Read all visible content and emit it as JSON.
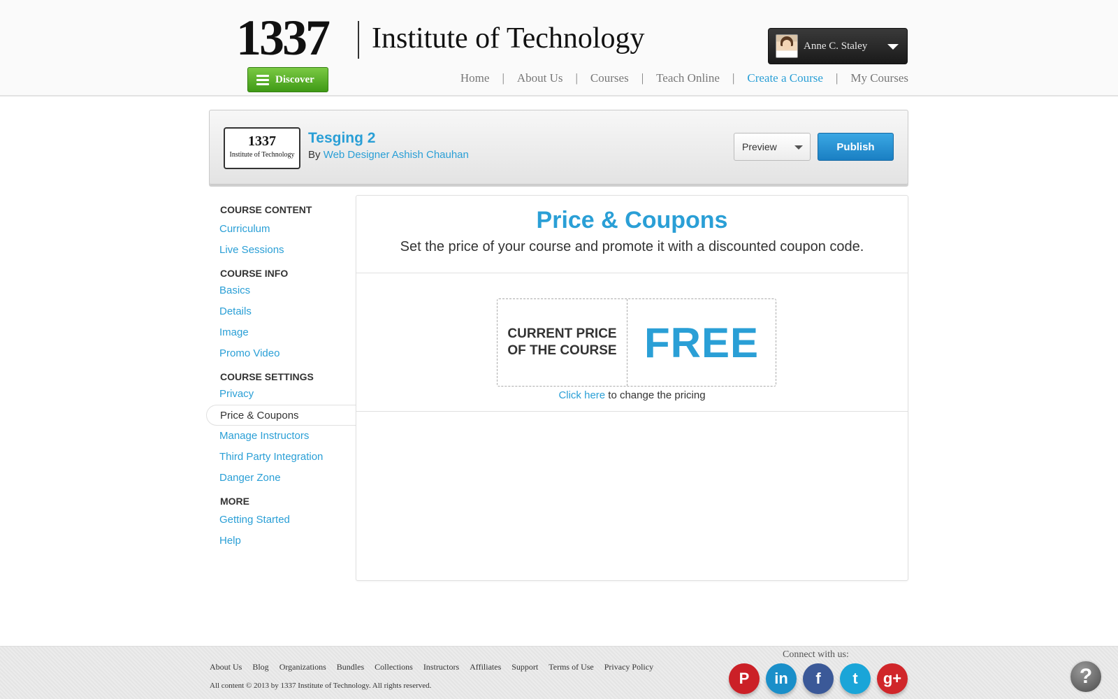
{
  "header": {
    "logo_number": "1337",
    "logo_name": "Institute of Technology",
    "discover_label": "Discover",
    "user_name": "Anne C. Staley",
    "nav": [
      {
        "label": "Home"
      },
      {
        "label": "About Us"
      },
      {
        "label": "Courses"
      },
      {
        "label": "Teach Online"
      },
      {
        "label": "Create a Course",
        "active": true
      },
      {
        "label": "My Courses"
      }
    ]
  },
  "course": {
    "logo_number": "1337",
    "logo_name": "Institute of Technology",
    "title": "Tesging 2",
    "by_prefix": "By",
    "author": "Web Designer Ashish Chauhan",
    "preview_label": "Preview",
    "publish_label": "Publish"
  },
  "sidebar": {
    "content_head": "COURSE CONTENT",
    "content_items": [
      "Curriculum",
      "Live Sessions"
    ],
    "info_head": "COURSE INFO",
    "info_items": [
      "Basics",
      "Details",
      "Image",
      "Promo Video"
    ],
    "settings_head": "COURSE SETTINGS",
    "settings_items": [
      "Privacy",
      "Price & Coupons",
      "Manage Instructors",
      "Third Party Integration",
      "Danger Zone"
    ],
    "more_head": "MORE",
    "more_items": [
      "Getting Started",
      "Help"
    ]
  },
  "main": {
    "title": "Price & Coupons",
    "subtitle": "Set the price of your course and promote it with a discounted coupon code.",
    "price_label": "CURRENT PRICE OF THE COURSE",
    "price_value": "FREE",
    "change_link": "Click here",
    "change_text": " to change the pricing"
  },
  "footer": {
    "links": [
      "About Us",
      "Blog",
      "Organizations",
      "Bundles",
      "Collections",
      "Instructors",
      "Affiliates",
      "Support",
      "Terms of Use",
      "Privacy Policy"
    ],
    "copyright": "All content © 2013 by 1337 Institute of Technology. All rights reserved.",
    "connect": "Connect with us:",
    "social": [
      {
        "name": "pinterest",
        "glyph": "P",
        "color": "#cb2027"
      },
      {
        "name": "linkedin",
        "glyph": "in",
        "color": "#1a8fc9"
      },
      {
        "name": "facebook",
        "glyph": "f",
        "color": "#3b5998"
      },
      {
        "name": "twitter",
        "glyph": "t",
        "color": "#1aa5d8"
      },
      {
        "name": "google-plus",
        "glyph": "g+",
        "color": "#d0262a"
      }
    ],
    "help_glyph": "?"
  }
}
